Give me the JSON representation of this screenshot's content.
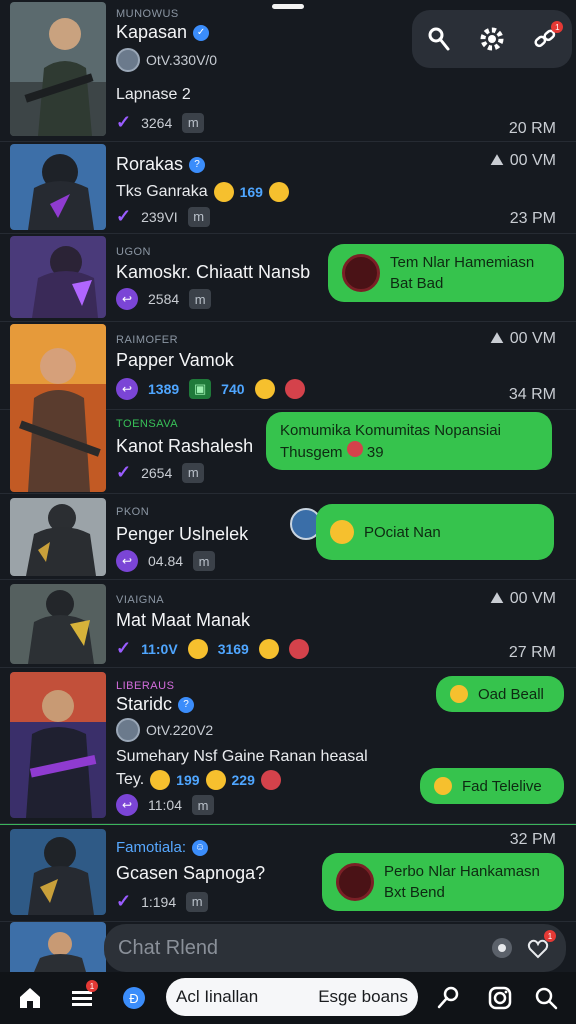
{
  "chats": [
    {
      "group": "MUNOWUS",
      "name": "Kapasan",
      "sub": "OtV.330V/0",
      "message": "Lapnase 2",
      "count": "3264",
      "meta_box": "m",
      "time": "20 RM"
    },
    {
      "name": "Rorakas",
      "message": "Tks Ganraka",
      "message_count": "169",
      "count": "239VI",
      "meta_box": "m",
      "top_time": "00 VM",
      "time": "23 PM"
    },
    {
      "group": "UGON",
      "name": "Kamoskr. Chiaatt Nansb",
      "count": "2584",
      "meta_box": "m",
      "bubble": [
        "Tem Nlar Hamemiasn",
        "Bat Bad"
      ]
    },
    {
      "group": "RAIMOFER",
      "name": "Papper Vamok",
      "stats": [
        "1389",
        "740"
      ],
      "top_time": "00 VM",
      "time": "34 RM"
    },
    {
      "group": "TOENSAVA",
      "name": "Kanot Rashalesh",
      "count": "2654",
      "meta_box": "m",
      "bubble": [
        "Komumika  Komumitas Nopansiai",
        "Thusgem",
        "39"
      ]
    },
    {
      "group": "PKON",
      "name": "Penger Uslnelek",
      "count": "04.84",
      "meta_box": "m",
      "bubble": [
        "POciat Nan"
      ]
    },
    {
      "group": "VIAIGNA",
      "name": "Mat Maat Manak",
      "stats": [
        "11:0V",
        "3169"
      ],
      "top_time": "00 VM",
      "time": "27 RM"
    },
    {
      "group": "LIBERAUS",
      "name": "Staridc",
      "sub": "OtV.220V2",
      "message": "Sumehary Nsf Gaine Ranan heasal",
      "message2": [
        "Tey.",
        "199",
        "229"
      ],
      "count": "11:04",
      "meta_box": "m",
      "bubble": [
        "Oad Beall"
      ],
      "bubble2": [
        "Fad Telelive"
      ]
    },
    {
      "group": "Famotiala:",
      "name": "Gcasen Sapnoga?",
      "count": "1:194",
      "meta_box": "m",
      "time": "32 PM",
      "bubble": [
        "Perbo Nlar Hankamasn",
        "Bxt Bend"
      ]
    }
  ],
  "input": {
    "placeholder": "Chat Rlend"
  },
  "nav": {
    "pill_left": "Acl Iinallan",
    "pill_right": "Esge boans",
    "badge": "1"
  },
  "top_badge": "1",
  "input_badge": "1",
  "colors": {
    "accent_green": "#36c34d",
    "tick_purple": "#9a5cff",
    "count_blue": "#4fa6ff"
  }
}
